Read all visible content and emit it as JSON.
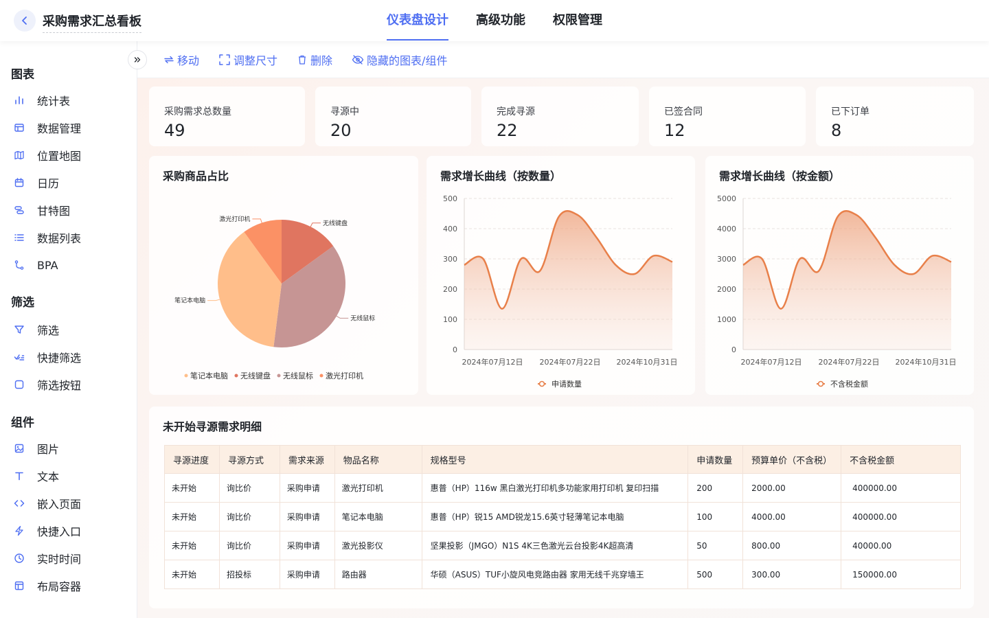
{
  "header": {
    "title": "采购需求汇总看板",
    "tabs": [
      {
        "label": "仪表盘设计",
        "active": true
      },
      {
        "label": "高级功能",
        "active": false
      },
      {
        "label": "权限管理",
        "active": false
      }
    ]
  },
  "sidebar": {
    "sections": [
      {
        "title": "图表",
        "items": [
          {
            "label": "统计表",
            "icon": "bar-chart-icon"
          },
          {
            "label": "数据管理",
            "icon": "table-icon"
          },
          {
            "label": "位置地图",
            "icon": "map-icon"
          },
          {
            "label": "日历",
            "icon": "calendar-icon"
          },
          {
            "label": "甘特图",
            "icon": "gantt-icon"
          },
          {
            "label": "数据列表",
            "icon": "list-icon"
          },
          {
            "label": "BPA",
            "icon": "flow-icon"
          }
        ]
      },
      {
        "title": "筛选",
        "items": [
          {
            "label": "筛选",
            "icon": "filter-icon"
          },
          {
            "label": "快捷筛选",
            "icon": "quick-filter-icon"
          },
          {
            "label": "筛选按钮",
            "icon": "square-icon"
          }
        ]
      },
      {
        "title": "组件",
        "items": [
          {
            "label": "图片",
            "icon": "image-icon"
          },
          {
            "label": "文本",
            "icon": "text-icon"
          },
          {
            "label": "嵌入页面",
            "icon": "code-icon"
          },
          {
            "label": "快捷入口",
            "icon": "lightning-icon"
          },
          {
            "label": "实时时间",
            "icon": "clock-icon"
          },
          {
            "label": "布局容器",
            "icon": "layout-icon"
          }
        ]
      }
    ]
  },
  "toolbar": {
    "move": "移动",
    "resize": "调整尺寸",
    "delete": "删除",
    "hidden": "隐藏的图表/组件"
  },
  "stats": [
    {
      "label": "采购需求总数量",
      "value": "49"
    },
    {
      "label": "寻源中",
      "value": "20"
    },
    {
      "label": "完成寻源",
      "value": "22"
    },
    {
      "label": "已签合同",
      "value": "12"
    },
    {
      "label": "已下订单",
      "value": "8"
    }
  ],
  "colors": {
    "accent": "#4e6ef2",
    "line": "#e8804a",
    "pie": [
      "#ffbe8a",
      "#e07560",
      "#c69594",
      "#fb9165"
    ]
  },
  "pie_card": {
    "title": "采购商品占比"
  },
  "line_card1": {
    "title": "需求增长曲线（按数量）"
  },
  "line_card2": {
    "title": "需求增长曲线（按金额）"
  },
  "table_card": {
    "title": "未开始寻源需求明细",
    "columns": [
      "寻源进度",
      "寻源方式",
      "需求来源",
      "物品名称",
      "规格型号",
      "申请数量",
      "预算单价（不含税）",
      "不含税金额"
    ],
    "rows": [
      [
        "未开始",
        "询比价",
        "采购申请",
        "激光打印机",
        "惠普（HP）116w 黑白激光打印机多功能家用打印机 复印扫描",
        "200",
        "2000.00",
        "400000.00"
      ],
      [
        "未开始",
        "询比价",
        "采购申请",
        "笔记本电脑",
        "惠普（HP）锐15 AMD锐龙15.6英寸轻薄笔记本电脑",
        "100",
        "4000.00",
        "400000.00"
      ],
      [
        "未开始",
        "询比价",
        "采购申请",
        "激光投影仪",
        "坚果投影（JMGO）N1S 4K三色激光云台投影4K超高清",
        "50",
        "800.00",
        "40000.00"
      ],
      [
        "未开始",
        "招投标",
        "采购申请",
        "路由器",
        "华硕（ASUS）TUF小旋风电竞路由器 家用无线千兆穿墙王",
        "500",
        "300.00",
        "150000.00"
      ]
    ]
  },
  "chart_data": [
    {
      "type": "pie",
      "title": "采购商品占比",
      "categories": [
        "笔记本电脑",
        "无线键盘",
        "无线鼠标",
        "激光打印机"
      ],
      "values": [
        38,
        15,
        37,
        10
      ],
      "legend": "bottom"
    },
    {
      "type": "area",
      "title": "需求增长曲线（按数量）",
      "x_ticks": [
        "2024年07月12日",
        "2024年07月22日",
        "2024年10月31日"
      ],
      "y_ticks": [
        0,
        100,
        200,
        300,
        400,
        500
      ],
      "ylim": [
        0,
        500
      ],
      "series": [
        {
          "name": "申请数量",
          "values": [
            280,
            300,
            135,
            300,
            260,
            440,
            445,
            370,
            280,
            250,
            310,
            290
          ]
        }
      ],
      "legend": "bottom"
    },
    {
      "type": "area",
      "title": "需求增长曲线（按金额）",
      "x_ticks": [
        "2024年07月12日",
        "2024年07月22日",
        "2024年10月31日"
      ],
      "y_ticks": [
        0,
        1000,
        2000,
        3000,
        4000,
        5000
      ],
      "ylim": [
        0,
        5000
      ],
      "series": [
        {
          "name": "不含税金额",
          "values": [
            2800,
            3000,
            1350,
            3000,
            2600,
            4400,
            4450,
            3700,
            2800,
            2500,
            3100,
            2900
          ]
        }
      ],
      "legend": "bottom"
    }
  ]
}
